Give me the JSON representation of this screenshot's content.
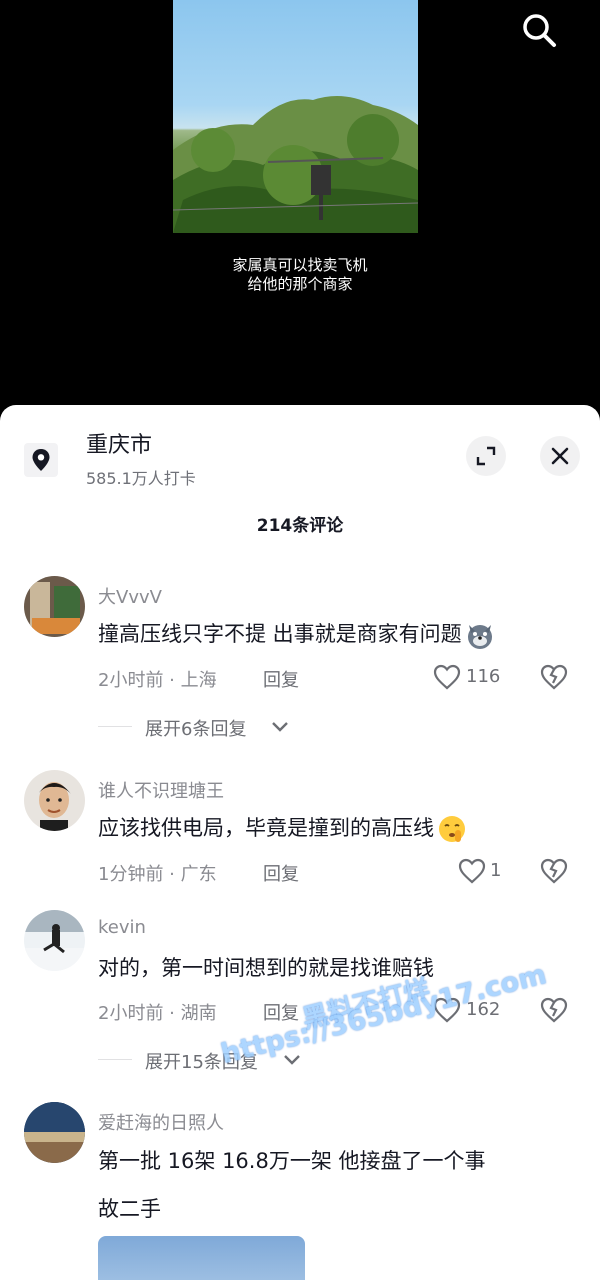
{
  "video": {
    "subtitle_line1": "家属真可以找卖飞机",
    "subtitle_line2": "给他的那个商家"
  },
  "location": {
    "title": "重庆市",
    "subtitle": "585.1万人打卡"
  },
  "comment_count": "214条评论",
  "comments": [
    {
      "username": "大VvvV",
      "text": "撞高压线只字不提 出事就是商家有问题",
      "emoji": "wolf-face-emoji",
      "time_location": "2小时前 · 上海",
      "reply_label": "回复",
      "likes": "116",
      "expand_label": "展开6条回复"
    },
    {
      "username": "谁人不识理塘王",
      "text": "应该找供电局，毕竟是撞到的高压线",
      "emoji": "shushing-face-emoji",
      "time_location": "1分钟前 · 广东",
      "reply_label": "回复",
      "likes": "1"
    },
    {
      "username": "kevin",
      "text": "对的，第一时间想到的就是找谁赔钱",
      "time_location": "2小时前 · 湖南",
      "reply_label": "回复",
      "likes": "162",
      "expand_label": "展开15条回复"
    },
    {
      "username": "爱赶海的日照人",
      "text_line1": "第一批 16架 16.8万一架   他接盘了一个事",
      "text_line2": "故二手"
    }
  ],
  "watermark": {
    "line1": "黑料不打烊",
    "line2": "https://365bdy17.com"
  },
  "colors": {
    "sheet_bg": "#ffffff",
    "muted_text": "#8a8b91",
    "primary_text": "#161823",
    "video_bg": "#000000"
  }
}
